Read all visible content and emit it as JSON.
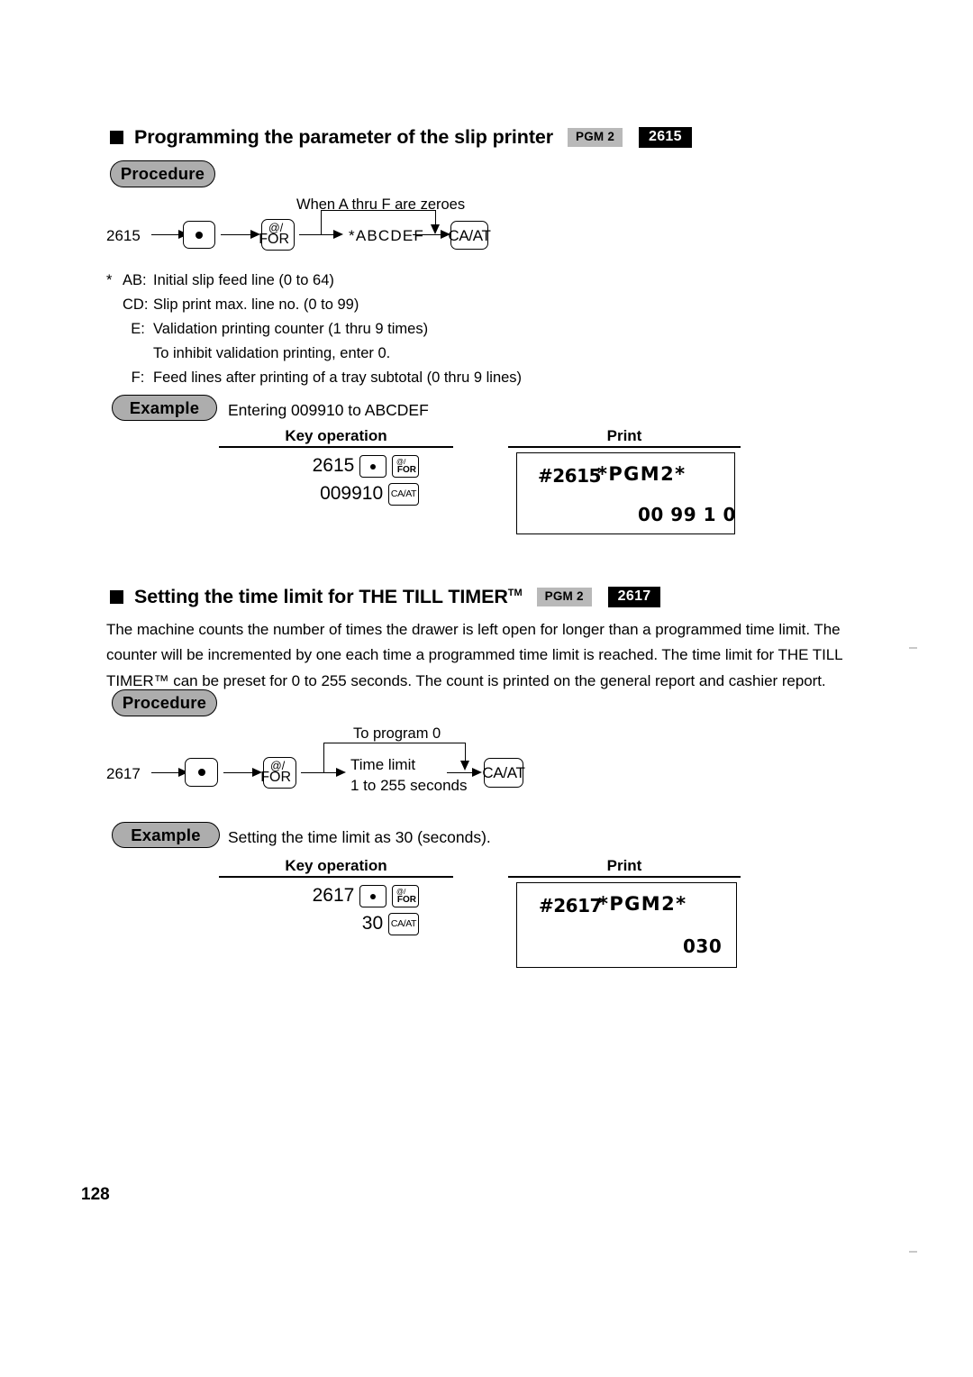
{
  "page": {
    "number": "128"
  },
  "sections": [
    {
      "bullet": "square-bullet",
      "title": "Programming the parameter of the slip printer",
      "badge_mode": "PGM 2",
      "badge_code": "2615",
      "procedure_label": "Procedure",
      "diagram": {
        "start_code": "2615",
        "key_dot": "·",
        "key_for_line1": "@/",
        "key_for_line2": "FOR",
        "branch_label": "When A thru F are zeroes",
        "middle_label": "*ABCDEF",
        "key_end": "CA/AT"
      },
      "legend": {
        "star": "*",
        "rows": [
          {
            "key": "AB:",
            "text": "Initial slip feed line (0 to 64)"
          },
          {
            "key": "CD:",
            "text": "Slip print max. line no. (0 to 99)"
          },
          {
            "key": "E:",
            "text": "Validation printing counter (1 thru 9 times)"
          },
          {
            "key": "",
            "text": "To inhibit validation printing, enter 0."
          },
          {
            "key": "F:",
            "text": "Feed lines after printing of a tray subtotal (0 thru 9 lines)"
          }
        ]
      },
      "example": {
        "label": "Example",
        "caption": "Entering 009910 to ABCDEF",
        "keyop_header": "Key operation",
        "print_header": "Print",
        "keyop_line1_number": "2615",
        "keyop_line2_number": "009910",
        "keyop_key_dot": "·",
        "keyop_key_for_line1": "@/",
        "keyop_key_for_line2": "FOR",
        "keyop_key_caat": "CA/AT",
        "receipt_hash": "#2615",
        "receipt_pgm": "*PGM2*",
        "receipt_value": "00 99 1 0"
      }
    },
    {
      "bullet": "square-bullet",
      "title": "Setting the time limit for THE TILL TIMER",
      "title_tm": "TM",
      "badge_mode": "PGM 2",
      "badge_code": "2617",
      "body_paragraph_lines": [
        "The machine counts the number of times the drawer is left open for longer than a programmed time limit.  The",
        "counter will be incremented by one each time a programmed time limit is reached.   The time limit for THE TILL",
        "TIMER™ can be preset for 0 to 255 seconds.  The count is printed on the general report and cashier report."
      ],
      "procedure_label": "Procedure",
      "diagram": {
        "start_code": "2617",
        "key_dot": "·",
        "key_for_line1": "@/",
        "key_for_line2": "FOR",
        "branch_label": "To program 0",
        "middle_label_line1": "Time limit",
        "middle_label_line2": "1 to 255 seconds",
        "key_end": "CA/AT"
      },
      "example": {
        "label": "Example",
        "caption": "Setting the time limit as 30 (seconds).",
        "keyop_header": "Key operation",
        "print_header": "Print",
        "keyop_line1_number": "2617",
        "keyop_line2_number": "30",
        "keyop_key_dot": "·",
        "keyop_key_for_line1": "@/",
        "keyop_key_for_line2": "FOR",
        "keyop_key_caat": "CA/AT",
        "receipt_hash": "#2617",
        "receipt_pgm": "*PGM2*",
        "receipt_value": "030"
      }
    }
  ],
  "colors": {
    "badge_mode_bg": "#b9b9b9",
    "badge_code_bg": "#000000",
    "pill_bg": "#adadad",
    "ink": "#000000",
    "paper": "#ffffff"
  }
}
